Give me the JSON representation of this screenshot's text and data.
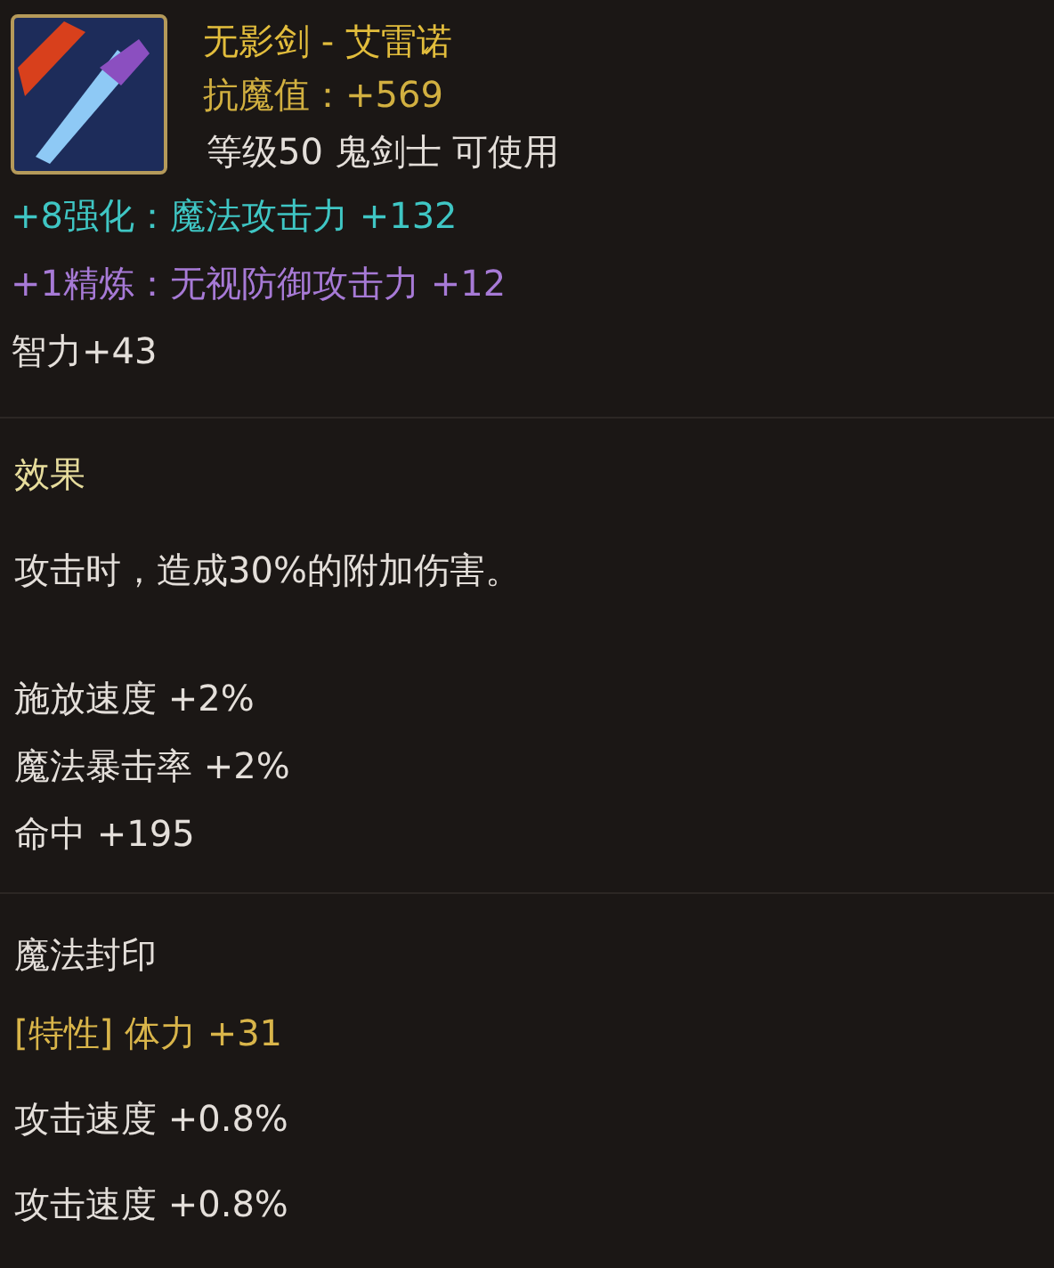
{
  "item": {
    "name": "无影剑 - 艾雷诺",
    "resist": "抗魔值：+569",
    "requirement": "等级50 鬼剑士 可使用"
  },
  "attributes": [
    {
      "kind": "enhance",
      "text": "+8强化：魔法攻击力 +132"
    },
    {
      "kind": "refine",
      "text": "+1精炼：无视防御攻击力 +12"
    },
    {
      "kind": "plain",
      "text": "智力+43"
    }
  ],
  "sections": [
    {
      "heading": "效果",
      "blocks": [
        [
          "攻击时，造成30%的附加伤害。"
        ],
        [
          "施放速度 +2%",
          "魔法暴击率 +2%",
          "命中 +195"
        ]
      ]
    }
  ],
  "seal": {
    "heading": "魔法封印",
    "lines": [
      {
        "kind": "trait",
        "text": "[特性] 体力 +31"
      },
      {
        "kind": "plain",
        "text": "攻击速度 +0.8%"
      },
      {
        "kind": "plain",
        "text": "攻击速度 +0.8%"
      }
    ]
  }
}
